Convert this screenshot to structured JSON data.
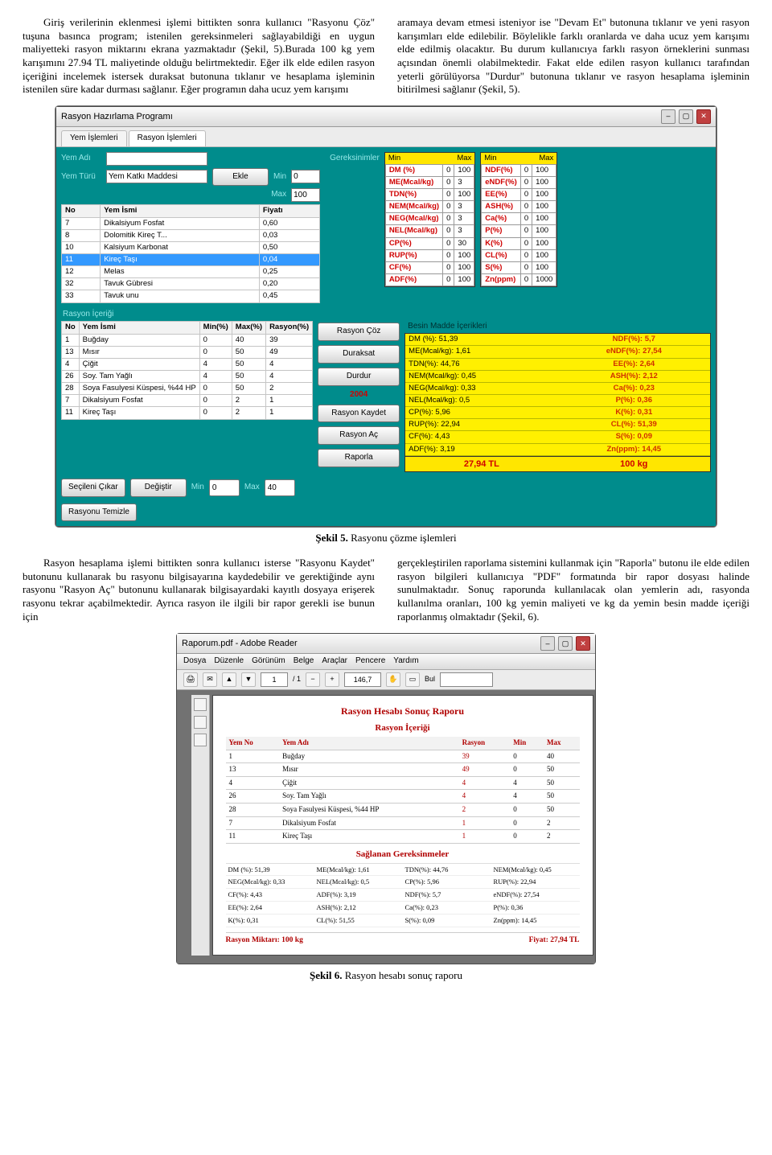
{
  "para1_a": "Giriş verilerinin eklenmesi işlemi bittikten sonra kullanıcı \"Rasyonu Çöz\" tuşuna basınca program; istenilen gereksinmeleri sağlayabildiği en uygun maliyetteki rasyon miktarını ekrana yazmaktadır (Şekil, 5).Burada 100 kg yem karışımını 27.94 TL maliyetinde olduğu belirtmektedir. Eğer ilk elde edilen rasyon içeriğini incelemek istersek duraksat butonuna tıklanır ve hesaplama işleminin istenilen süre kadar durması sağlanır. Eğer programın daha ucuz yem karışımı",
  "para1_b": "aramaya devam etmesi isteniyor ise \"Devam Et\" butonuna tıklanır ve yeni rasyon karışımları elde edilebilir. Böylelikle farklı oranlarda ve daha ucuz yem karışımı elde edilmiş olacaktır. Bu durum kullanıcıya farklı rasyon örneklerini sunması açısından önemli olabilmektedir. Fakat elde edilen rasyon kullanıcı tarafından yeterli görülüyorsa \"Durdur\" butonuna tıklanır ve rasyon hesaplama işleminin bitirilmesi sağlanır (Şekil, 5).",
  "caption5": "Şekil 5. Rasyonu çözme işlemleri",
  "para2_a": "Rasyon hesaplama işlemi bittikten sonra kullanıcı isterse \"Rasyonu Kaydet\" butonunu kullanarak bu rasyonu bilgisayarına kaydedebilir ve gerektiğinde aynı rasyonu \"Rasyon Aç\" butonunu kullanarak bilgisayardaki kayıtlı dosyaya erişerek rasyonu tekrar açabilmektedir. Ayrıca rasyon ile ilgili bir rapor gerekli ise bunun için",
  "para2_b": "gerçekleştirilen raporlama sistemini kullanmak için \"Raporla\" butonu ile elde edilen rasyon bilgileri kullanıcıya \"PDF\" formatında bir rapor dosyası halinde sunulmaktadır. Sonuç raporunda kullanılacak olan yemlerin adı, rasyonda kullanılma oranları, 100 kg yemin maliyeti ve kg da yemin besin madde içeriği raporlanmış olmaktadır (Şekil, 6).",
  "caption6": "Şekil 6. Rasyon hesabı sonuç raporu",
  "app": {
    "title": "Rasyon Hazırlama Programı",
    "tabs": {
      "t1": "Yem İşlemleri",
      "t2": "Rasyon İşlemleri"
    },
    "labels": {
      "yemAdi": "Yem Adı",
      "yemTuru": "Yem Türü",
      "turu": "Yem Katkı Maddesi",
      "ekle": "Ekle",
      "min": "Min",
      "max": "Max",
      "minv": "0",
      "maxv": "100",
      "gerek": "Gereksinimler"
    },
    "yemTable": {
      "cols": {
        "no": "No",
        "isim": "Yem İsmi",
        "fiyat": "Fiyatı"
      },
      "rows": [
        {
          "no": "7",
          "isim": "Dikalsiyum Fosfat",
          "fiyat": "0,60"
        },
        {
          "no": "8",
          "isim": "Dolomitik Kireç T...",
          "fiyat": "0,03"
        },
        {
          "no": "10",
          "isim": "Kalsiyum Karbonat",
          "fiyat": "0,50"
        },
        {
          "no": "11",
          "isim": "Kireç Taşı",
          "fiyat": "0,04",
          "sel": true
        },
        {
          "no": "12",
          "isim": "Melas",
          "fiyat": "0,25"
        },
        {
          "no": "32",
          "isim": "Tavuk Gübresi",
          "fiyat": "0,20"
        },
        {
          "no": "33",
          "isim": "Tavuk unu",
          "fiyat": "0,45"
        }
      ]
    },
    "gerekLeft": [
      {
        "k": "DM (%)",
        "min": "0",
        "max": "100"
      },
      {
        "k": "ME(Mcal/kg)",
        "min": "0",
        "max": "3"
      },
      {
        "k": "TDN(%)",
        "min": "0",
        "max": "100"
      },
      {
        "k": "NEM(Mcal/kg)",
        "min": "0",
        "max": "3"
      },
      {
        "k": "NEG(Mcal/kg)",
        "min": "0",
        "max": "3"
      },
      {
        "k": "NEL(Mcal/kg)",
        "min": "0",
        "max": "3"
      },
      {
        "k": "CP(%)",
        "min": "0",
        "max": "30"
      },
      {
        "k": "RUP(%)",
        "min": "0",
        "max": "100"
      },
      {
        "k": "CF(%)",
        "min": "0",
        "max": "100"
      },
      {
        "k": "ADF(%)",
        "min": "0",
        "max": "100"
      }
    ],
    "gerekRight": [
      {
        "k": "NDF(%)",
        "min": "0",
        "max": "100"
      },
      {
        "k": "eNDF(%)",
        "min": "0",
        "max": "100"
      },
      {
        "k": "EE(%)",
        "min": "0",
        "max": "100"
      },
      {
        "k": "ASH(%)",
        "min": "0",
        "max": "100"
      },
      {
        "k": "Ca(%)",
        "min": "0",
        "max": "100"
      },
      {
        "k": "P(%)",
        "min": "0",
        "max": "100"
      },
      {
        "k": "K(%)",
        "min": "0",
        "max": "100"
      },
      {
        "k": "CL(%)",
        "min": "0",
        "max": "100"
      },
      {
        "k": "S(%)",
        "min": "0",
        "max": "100"
      },
      {
        "k": "Zn(ppm)",
        "min": "0",
        "max": "1000"
      }
    ],
    "ri": {
      "title": "Rasyon İçeriği",
      "cols": {
        "no": "No",
        "isim": "Yem İsmi",
        "min": "Min(%)",
        "max": "Max(%)",
        "rasy": "Rasyon(%)"
      },
      "rows": [
        {
          "no": "1",
          "isim": "Buğday",
          "min": "0",
          "max": "40",
          "rasy": "39"
        },
        {
          "no": "13",
          "isim": "Mısır",
          "min": "0",
          "max": "50",
          "rasy": "49"
        },
        {
          "no": "4",
          "isim": "Çiğit",
          "min": "4",
          "max": "50",
          "rasy": "4"
        },
        {
          "no": "26",
          "isim": "Soy. Tam Yağlı",
          "min": "4",
          "max": "50",
          "rasy": "4"
        },
        {
          "no": "28",
          "isim": "Soya Fasulyesi Küspesi, %44 HP",
          "min": "0",
          "max": "50",
          "rasy": "2"
        },
        {
          "no": "7",
          "isim": "Dikalsiyum Fosfat",
          "min": "0",
          "max": "2",
          "rasy": "1"
        },
        {
          "no": "11",
          "isim": "Kireç Taşı",
          "min": "0",
          "max": "2",
          "rasy": "1"
        }
      ],
      "btns": {
        "coz": "Rasyon Çöz",
        "dks": "Duraksat",
        "dur": "Durdur",
        "kaydet": "Rasyon Kaydet",
        "ac": "Rasyon Aç",
        "rapor": "Raporla",
        "cost": "2004"
      }
    },
    "besinHead": "Besin Madde İçerikleri",
    "besinLeft": [
      "DM (%): 51,39",
      "ME(Mcal/kg): 1,61",
      "TDN(%): 44,76",
      "NEM(Mcal/kg): 0,45",
      "NEG(Mcal/kg): 0,33",
      "NEL(Mcal/kg): 0,5",
      "CP(%): 5,96",
      "RUP(%): 22,94",
      "CF(%): 4,43",
      "ADF(%): 3,19"
    ],
    "besinRight": [
      "NDF(%): 5,7",
      "eNDF(%): 27,54",
      "EE(%): 2,64",
      "ASH(%): 2,12",
      "Ca(%): 0,23",
      "P(%): 0,36",
      "K(%): 0,31",
      "CL(%): 51,39",
      "S(%): 0,09",
      "Zn(ppm): 14,45"
    ],
    "tot": {
      "price": "27,94 TL",
      "amount": "100 kg"
    },
    "bottom": {
      "cikar": "Seçileni Çıkar",
      "degis": "Değiştir",
      "mn": "Min",
      "mnv": "0",
      "mx": "Max",
      "mxv": "40",
      "temiz": "Rasyonu Temizle"
    }
  },
  "pdf": {
    "title": "Raporum.pdf - Adobe Reader",
    "menu": [
      "Dosya",
      "Düzenle",
      "Görünüm",
      "Belge",
      "Araçlar",
      "Pencere",
      "Yardım"
    ],
    "toolbar": {
      "page": "1",
      "of": "/ 1",
      "zoom": "146,7",
      "find": "Bul"
    },
    "h1": "Rasyon Hesabı Sonuç Raporu",
    "h2": "Rasyon İçeriği",
    "cols": {
      "no": "Yem No",
      "ad": "Yem Adı",
      "rasy": "Rasyon",
      "min": "Min",
      "max": "Max"
    },
    "rows": [
      {
        "no": "1",
        "ad": "Buğday",
        "r": "39",
        "mn": "0",
        "mx": "40"
      },
      {
        "no": "13",
        "ad": "Mısır",
        "r": "49",
        "mn": "0",
        "mx": "50"
      },
      {
        "no": "4",
        "ad": "Çiğit",
        "r": "4",
        "mn": "4",
        "mx": "50"
      },
      {
        "no": "26",
        "ad": "Soy. Tam Yağlı",
        "r": "4",
        "mn": "4",
        "mx": "50"
      },
      {
        "no": "28",
        "ad": "Soya Fasulyesi Küspesi, %44 HP",
        "r": "2",
        "mn": "0",
        "mx": "50"
      },
      {
        "no": "7",
        "ad": "Dikalsiyum Fosfat",
        "r": "1",
        "mn": "0",
        "mx": "2"
      },
      {
        "no": "11",
        "ad": "Kireç Taşı",
        "r": "1",
        "mn": "0",
        "mx": "2"
      }
    ],
    "h3": "Sağlanan Gereksinmeler",
    "stats": [
      "DM (%): 51,39",
      "ME(Mcal/kg): 1,61",
      "TDN(%): 44,76",
      "NEM(Mcal/kg): 0,45",
      "NEG(Mcal/kg): 0,33",
      "NEL(Mcal/kg): 0,5",
      "CP(%): 5,96",
      "RUP(%): 22,94",
      "CF(%): 4,43",
      "ADF(%): 3,19",
      "NDF(%): 5,7",
      "eNDF(%): 27,54",
      "EE(%): 2,64",
      "ASH(%): 2,12",
      "Ca(%): 0,23",
      "P(%): 0,36",
      "K(%): 0,31",
      "CL(%): 51,55",
      "S(%): 0,09",
      "Zn(ppm): 14,45"
    ],
    "foot": {
      "l": "Rasyon Miktarı: 100 kg",
      "r": "Fiyat: 27,94 TL"
    }
  }
}
